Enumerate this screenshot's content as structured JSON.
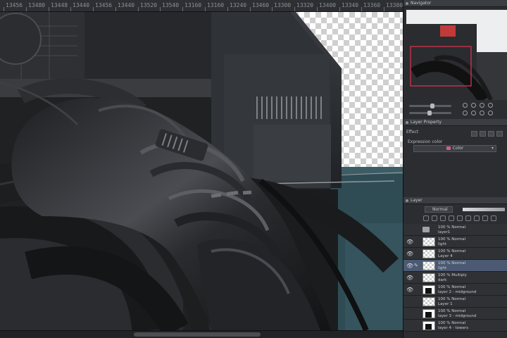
{
  "ruler": {
    "ticks": [
      "13456",
      "13480",
      "13448",
      "13440",
      "13456",
      "13440",
      "13520",
      "13540",
      "13160",
      "13160",
      "13240",
      "13460",
      "13300",
      "13320",
      "13400",
      "13340",
      "13360",
      "13380"
    ]
  },
  "panels": {
    "navigator": {
      "title": "Navigator"
    },
    "layer_property": {
      "title": "Layer Property",
      "effect_label": "Effect",
      "expression_color_label": "Expression color",
      "color_value": "Color"
    },
    "layer": {
      "title": "Layer",
      "blend_mode": "Normal"
    }
  },
  "layers": [
    {
      "mode": "100 % Normal",
      "name": "layer1",
      "thumb": "folder",
      "visible": false,
      "selected": false,
      "pen": false
    },
    {
      "mode": "100 % Normal",
      "name": "light",
      "thumb": "checker",
      "visible": true,
      "selected": false,
      "pen": false
    },
    {
      "mode": "100 % Normal",
      "name": "Layer 4",
      "thumb": "checker",
      "visible": true,
      "selected": false,
      "pen": false
    },
    {
      "mode": "100 % Normal",
      "name": "light",
      "thumb": "checker",
      "visible": true,
      "selected": true,
      "pen": true
    },
    {
      "mode": "100 % Multiply",
      "name": "dark",
      "thumb": "checker",
      "visible": true,
      "selected": false,
      "pen": false
    },
    {
      "mode": "100 % Normal",
      "name": "layer 2 - midground",
      "thumb": "dark",
      "visible": true,
      "selected": false,
      "pen": false
    },
    {
      "mode": "100 % Normal",
      "name": "Layer 1",
      "thumb": "checker",
      "visible": false,
      "selected": false,
      "pen": false
    },
    {
      "mode": "100 % Normal",
      "name": "layer 3 - midground",
      "thumb": "dark",
      "visible": false,
      "selected": false,
      "pen": false
    },
    {
      "mode": "100 % Normal",
      "name": "layer 4 - towers",
      "thumb": "dark",
      "visible": false,
      "selected": false,
      "pen": false
    }
  ],
  "icons": {
    "visible": "eye-icon",
    "edit": "pen-icon",
    "folder": "folder-icon"
  },
  "colors": {
    "selection": "#4b5a72",
    "sky_teal": "#2f4c54",
    "nav_frame": "#c0304a"
  }
}
